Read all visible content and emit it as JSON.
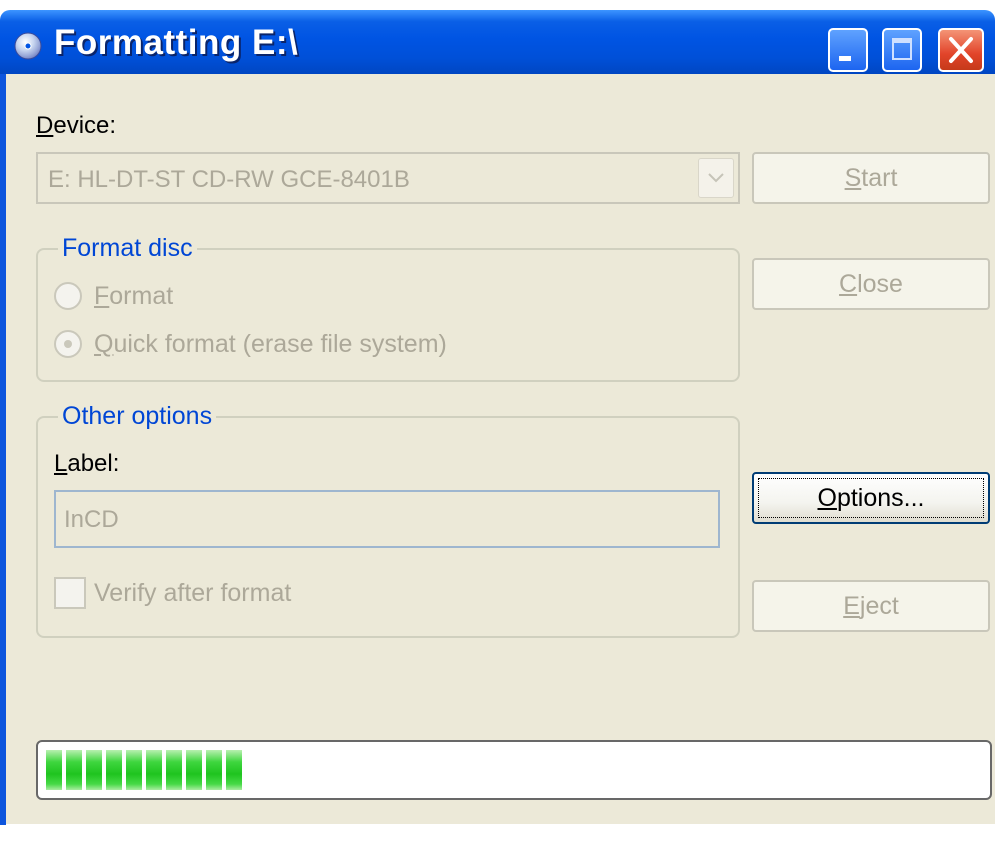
{
  "window": {
    "title": "Formatting E:\\",
    "icon": "cd-disc-icon"
  },
  "device": {
    "label_accel": "D",
    "label_rest": "evice:",
    "selected": "E: HL-DT-ST CD-RW GCE-8401B"
  },
  "format_disc": {
    "title": "Format disc",
    "options": [
      {
        "accel": "F",
        "rest": "ormat",
        "checked": false
      },
      {
        "accel": "Q",
        "rest": "uick format (erase file system)",
        "checked": true
      }
    ]
  },
  "other_options": {
    "title": "Other options",
    "label_accel": "L",
    "label_rest": "abel:",
    "label_value": "InCD",
    "verify_text": "Verify after format",
    "verify_checked": false
  },
  "buttons": {
    "start": {
      "accel": "S",
      "rest": "tart"
    },
    "close": {
      "accel": "C",
      "rest": "lose"
    },
    "options": {
      "accel": "O",
      "rest": "ptions..."
    },
    "eject": {
      "accel": "E",
      "rest": "ject"
    }
  },
  "progress": {
    "value_fraction": 0.22,
    "color": "#28c828"
  }
}
